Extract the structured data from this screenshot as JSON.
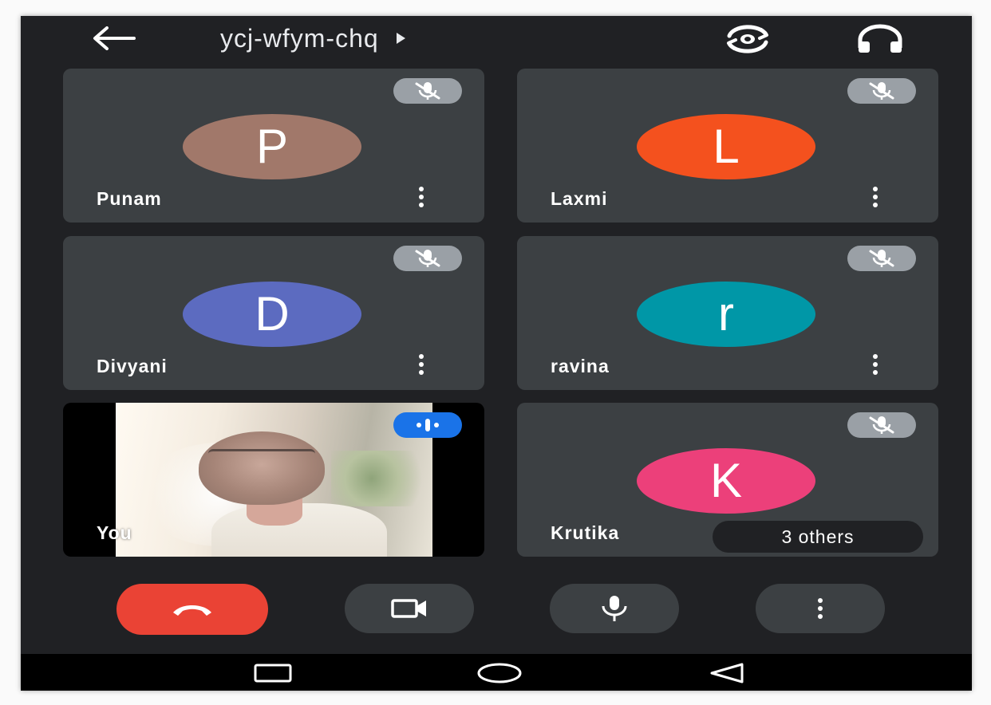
{
  "topbar": {
    "meeting_code": "ycj-wfym-chq",
    "icons": {
      "back": "arrow-left-icon",
      "caret": "play-caret-icon",
      "switch_camera": "switch-camera-icon",
      "audio_output": "headphones-icon"
    }
  },
  "participants": [
    {
      "name": "Punam",
      "initial": "P",
      "avatar_color": "#a1786a",
      "muted": true
    },
    {
      "name": "Laxmi",
      "initial": "L",
      "avatar_color": "#f4511e",
      "muted": true
    },
    {
      "name": "Divyani",
      "initial": "D",
      "avatar_color": "#5c6bc0",
      "muted": true
    },
    {
      "name": "ravina",
      "initial": "r",
      "avatar_color": "#0097a7",
      "muted": true
    },
    {
      "name": "You",
      "self": true,
      "speaking": true
    },
    {
      "name": "Krutika",
      "initial": "K",
      "avatar_color": "#ec407a",
      "muted": true
    }
  ],
  "others_label": "3 others",
  "controls": {
    "end_call_color": "#ea4335",
    "icons": [
      "end-call-icon",
      "camera-icon",
      "microphone-icon",
      "more-vertical-icon"
    ]
  },
  "navbar": {
    "icons": [
      "recents-icon",
      "home-icon",
      "back-triangle-icon"
    ]
  },
  "colors": {
    "background": "#202124",
    "tile": "#3c4043",
    "muted_badge": "#9aa0a6",
    "speaking_badge": "#1a73e8"
  }
}
